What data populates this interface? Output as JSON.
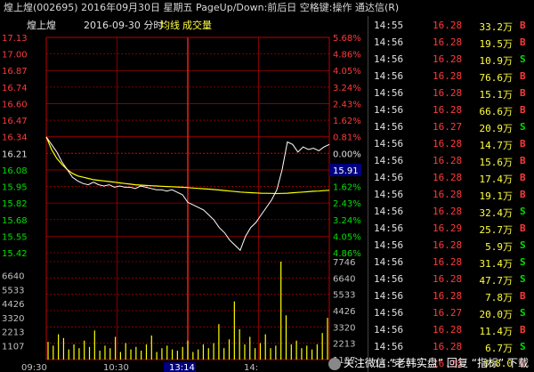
{
  "title": "煌上煌(002695) 2016年09月30日 星期五 PageUp/Down:前后日 空格键:操作 通达信(R)",
  "chart_header": {
    "name": "煌上煌",
    "date": "2016-09-30 分时",
    "avg_label": "均线",
    "vol_label": "成交量"
  },
  "price_labels": [
    "17.13",
    "17.00",
    "16.87",
    "16.74",
    "16.60",
    "16.47",
    "16.34",
    "16.21",
    "16.08",
    "15.95",
    "15.82",
    "15.68",
    "15.55",
    "15.42"
  ],
  "pct_labels": [
    "5.68%",
    "4.86%",
    "4.05%",
    "3.24%",
    "2.43%",
    "1.62%",
    "0.81%",
    "0.00%",
    "0.81%",
    "1.62%",
    "2.43%",
    "3.24%",
    "4.05%",
    "4.86%"
  ],
  "current_price_tag": "15.91",
  "vol_labels_left": [
    "6640",
    "5533",
    "4426",
    "3320",
    "2213",
    "1107"
  ],
  "vol_labels_right": [
    "7746",
    "6640",
    "5533",
    "4426",
    "3320",
    "2213",
    "1107"
  ],
  "time_labels": [
    "09:30",
    "10:30",
    "13:14",
    "14:"
  ],
  "colors": {
    "up": "#ff3a3a",
    "down": "#00e000",
    "price_line": "#ffffff",
    "avg_line": "#ffff00",
    "grid": "#a00000",
    "volume": "#ffff00"
  },
  "chart_data": {
    "type": "line",
    "title": "",
    "xlabel": "",
    "ylabel": "",
    "ylim": [
      15.42,
      17.13
    ],
    "grid": true,
    "series": [
      {
        "name": "价格",
        "values": [
          16.34,
          16.28,
          16.22,
          16.14,
          16.08,
          16.02,
          15.99,
          15.97,
          15.96,
          15.98,
          15.96,
          15.95,
          15.96,
          15.94,
          15.95,
          15.94,
          15.94,
          15.93,
          15.95,
          15.94,
          15.93,
          15.92,
          15.92,
          15.91,
          15.92,
          15.9,
          15.88,
          15.82,
          15.8,
          15.78,
          15.76,
          15.72,
          15.68,
          15.62,
          15.58,
          15.52,
          15.48,
          15.44,
          15.55,
          15.62,
          15.66,
          15.72,
          15.78,
          15.84,
          15.92,
          16.08,
          16.3,
          16.28,
          16.22,
          16.26,
          16.24,
          16.25,
          16.23,
          16.26,
          16.28
        ]
      },
      {
        "name": "均线",
        "values": [
          16.34,
          16.24,
          16.17,
          16.12,
          16.08,
          16.05,
          16.03,
          16.02,
          16.01,
          16.0,
          15.995,
          15.99,
          15.985,
          15.98,
          15.975,
          15.97,
          15.965,
          15.96,
          15.957,
          15.954,
          15.952,
          15.95,
          15.948,
          15.946,
          15.944,
          15.942,
          15.94,
          15.937,
          15.934,
          15.931,
          15.928,
          15.925,
          15.922,
          15.918,
          15.914,
          15.91,
          15.906,
          15.902,
          15.899,
          15.897,
          15.895,
          15.893,
          15.892,
          15.891,
          15.89,
          15.891,
          15.893,
          15.896,
          15.899,
          15.902,
          15.905,
          15.908,
          15.91,
          15.913,
          15.916
        ]
      }
    ],
    "volume": [
      1400,
      1100,
      2000,
      1700,
      800,
      1200,
      900,
      1500,
      1000,
      2300,
      700,
      1100,
      900,
      1800,
      600,
      1300,
      800,
      1000,
      700,
      1200,
      1900,
      600,
      900,
      1100,
      800,
      700,
      1000,
      1500,
      600,
      800,
      1200,
      900,
      1300,
      2800,
      900,
      1600,
      4600,
      2400,
      1200,
      1800,
      900,
      1300,
      2000,
      900,
      1100,
      7746,
      3500,
      1200,
      1500,
      900,
      1100,
      800,
      1200,
      2100,
      3300
    ]
  },
  "ticks": [
    {
      "time": "14:55",
      "price": "16.28",
      "vol": "33.2万",
      "side": "B"
    },
    {
      "time": "14:56",
      "price": "16.28",
      "vol": "19.5万",
      "side": "B"
    },
    {
      "time": "14:56",
      "price": "16.28",
      "vol": "10.9万",
      "side": "S"
    },
    {
      "time": "14:56",
      "price": "16.28",
      "vol": "76.6万",
      "side": "B"
    },
    {
      "time": "14:56",
      "price": "16.28",
      "vol": "15.1万",
      "side": "B"
    },
    {
      "time": "14:56",
      "price": "16.28",
      "vol": "66.6万",
      "side": "B"
    },
    {
      "time": "14:56",
      "price": "16.27",
      "vol": "20.9万",
      "side": "S"
    },
    {
      "time": "14:56",
      "price": "16.28",
      "vol": "14.7万",
      "side": "B"
    },
    {
      "time": "14:56",
      "price": "16.28",
      "vol": "15.6万",
      "side": "B"
    },
    {
      "time": "14:56",
      "price": "16.28",
      "vol": "17.4万",
      "side": "B"
    },
    {
      "time": "14:56",
      "price": "16.28",
      "vol": "19.1万",
      "side": "B"
    },
    {
      "time": "14:56",
      "price": "16.28",
      "vol": "32.4万",
      "side": "S"
    },
    {
      "time": "14:56",
      "price": "16.29",
      "vol": "25.7万",
      "side": "B"
    },
    {
      "time": "14:56",
      "price": "16.28",
      "vol": "5.9万",
      "side": "S"
    },
    {
      "time": "14:56",
      "price": "16.28",
      "vol": "31.4万",
      "side": "S"
    },
    {
      "time": "14:56",
      "price": "16.28",
      "vol": "47.7万",
      "side": "S"
    },
    {
      "time": "14:56",
      "price": "16.28",
      "vol": "7.8万",
      "side": "B"
    },
    {
      "time": "14:56",
      "price": "16.27",
      "vol": "20.0万",
      "side": "S"
    },
    {
      "time": "14:56",
      "price": "16.28",
      "vol": "11.4万",
      "side": "B"
    },
    {
      "time": "14:56",
      "price": "16.28",
      "vol": "6.7万",
      "side": "S"
    },
    {
      "time": "14:57",
      "price": "16.28",
      "vol": "858.0万",
      "side": "B"
    }
  ],
  "watermark": "关注微信 “老韩实盘” 回复 “指标” 下载"
}
